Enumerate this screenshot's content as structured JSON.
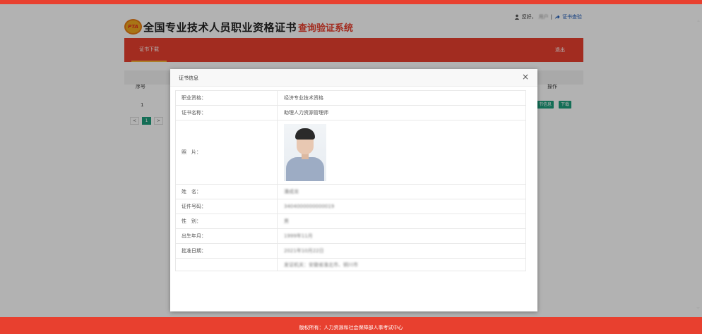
{
  "header": {
    "logo_badge": "PTA",
    "title_main": "全国专业技术人员职业资格证书",
    "title_red": "查询验证系统",
    "greeting": "您好，",
    "username": "用户",
    "separator": "|",
    "verify_link": "证书查验"
  },
  "nav": {
    "tab": "证书下载",
    "logout": "退出"
  },
  "table": {
    "col_index": "序号",
    "col_op": "操作",
    "row_index": "1",
    "btn_info": "书信息",
    "btn_download": "下载"
  },
  "pager": {
    "prev": "<",
    "current": "1",
    "next": ">"
  },
  "modal": {
    "title": "证书信息",
    "close": "×",
    "rows": [
      {
        "label": "职业资格：",
        "value": "经济专业技术资格"
      },
      {
        "label": "证书名称：",
        "value": "助理人力资源管理师"
      },
      {
        "label": "照　片：",
        "value": ""
      },
      {
        "label": "姓　名：",
        "value": "潘成龙"
      },
      {
        "label": "证件号码：",
        "value": "3404000000000019"
      },
      {
        "label": "性　别：",
        "value": "男"
      },
      {
        "label": "出生年月：",
        "value": "1999年11月"
      },
      {
        "label": "批准日期：",
        "value": "2021年10月22日"
      },
      {
        "label": "",
        "value": "发证机关：安徽省淮北市、铜川市"
      }
    ]
  },
  "footer": {
    "text": "版权所有：人力资源和社会保障部人事考试中心"
  },
  "colors": {
    "brand_red": "#e8402f",
    "accent_green": "#1e9e7c",
    "link_blue": "#1e5bb8"
  }
}
